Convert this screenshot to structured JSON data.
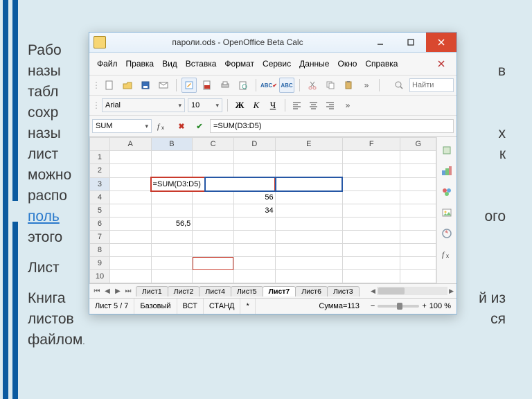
{
  "slide": {
    "text1": "Рабо",
    "text2": "назы",
    "text3": "табл",
    "text4": "сохр",
    "text5": "назы",
    "text6": "лист",
    "text7": "можно",
    "text8": "распо",
    "text9_link": "поль",
    "text10": "этого",
    "para2": "Лист",
    "para3a": "Книга",
    "para3b": "листов",
    "para3c": "файлом",
    "tail1": "в",
    "tail2": "х",
    "tail3": "к",
    "tail4": "ого",
    "tail5": "й из",
    "tail6": "ся"
  },
  "app": {
    "title": "пароли.ods - OpenOffice Beta Calc",
    "find_label": "Найти"
  },
  "menu": {
    "file": "Файл",
    "edit": "Правка",
    "view": "Вид",
    "insert": "Вставка",
    "format": "Формат",
    "tools": "Сервис",
    "data": "Данные",
    "window": "Окно",
    "help": "Справка"
  },
  "font": {
    "name": "Arial",
    "size": "10",
    "bold": "Ж",
    "italic": "К",
    "underline": "Ч"
  },
  "formula": {
    "namebox": "SUM",
    "input": "=SUM(D3:D5)",
    "cell_b3": "=SUM(D3:D5)",
    "d4": "56",
    "d5": "34",
    "b6": "56,5"
  },
  "cols": {
    "A": "A",
    "B": "B",
    "C": "C",
    "D": "D",
    "E": "E",
    "F": "F",
    "G": "G"
  },
  "rows": {
    "r1": "1",
    "r2": "2",
    "r3": "3",
    "r4": "4",
    "r5": "5",
    "r6": "6",
    "r7": "7",
    "r8": "8",
    "r9": "9",
    "r10": "10"
  },
  "tabs": {
    "t1": "Лист1",
    "t2": "Лист2",
    "t4": "Лист4",
    "t5": "Лист5",
    "t7": "Лист7",
    "t6": "Лист6",
    "t3": "Лист3"
  },
  "status": {
    "pos": "Лист 5 / 7",
    "style": "Базовый",
    "ins": "ВСТ",
    "std": "СТАНД",
    "mod": "*",
    "sum": "Сумма=113",
    "zoom": "100 %"
  }
}
